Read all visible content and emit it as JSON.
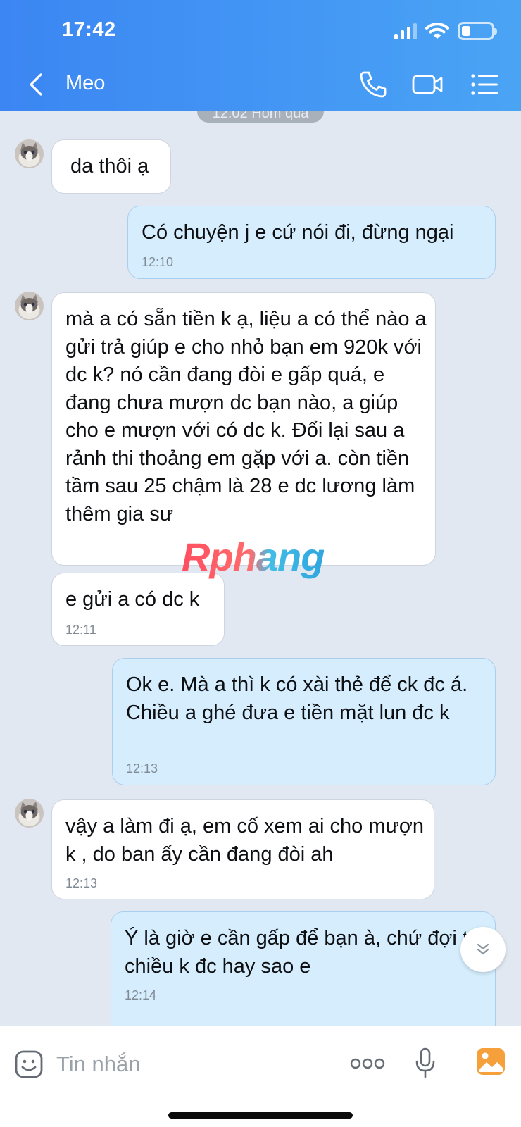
{
  "status_bar": {
    "time": "17:42",
    "battery_level": 0.3
  },
  "header": {
    "contact_name": "Meo"
  },
  "date_separator": "12:02 Hôm qua",
  "messages": [
    {
      "sender": "them",
      "text": "da thôi ạ",
      "time": ""
    },
    {
      "sender": "me",
      "text": "Có chuyện j e cứ nói đi, đừng ngại",
      "time": "12:10"
    },
    {
      "sender": "them",
      "text": "mà a có sẵn tiền k ạ, liệu a có thể nào a gửi trả giúp e cho nhỏ bạn em 920k với dc k? nó cần đang đòi e gấp quá, e đang chưa mượn dc bạn nào, a giúp cho e mượn với có dc k. Đổi lại sau a rảnh thi thoảng em gặp với a. còn tiền tầm sau 25 chậm là 28 e dc lương làm thêm gia sư",
      "time": ""
    },
    {
      "sender": "them",
      "text": "e gửi a có dc k",
      "time": "12:11"
    },
    {
      "sender": "me",
      "text": "Ok e. Mà a thì k có xài thẻ để ck đc á. Chiều a ghé đưa e tiền mặt lun đc k",
      "time": "12:13"
    },
    {
      "sender": "them",
      "text": "vậy a làm đi ạ, em cố xem ai cho mượn k , do ban ấy cần đang đòi ah",
      "time": "12:13"
    },
    {
      "sender": "me",
      "text": "Ý là giờ e cần gấp để bạn à, chứ đợi tới chiều k đc hay sao e",
      "time": "12:14"
    }
  ],
  "watermark": "Rphang",
  "composer": {
    "placeholder": "Tin nhắn"
  },
  "icons": {
    "back": "chevron-left-icon",
    "call": "phone-icon",
    "video": "video-camera-icon",
    "menu": "list-menu-icon",
    "sticker": "smiley-icon",
    "more": "more-dots-icon",
    "voice": "microphone-icon",
    "photo": "photo-gallery-icon",
    "scroll": "double-chevron-down-icon"
  },
  "colors": {
    "header_start": "#3b86f3",
    "header_end": "#4aa4f4",
    "bubble_out": "#d5edfd",
    "bubble_in": "#ffffff",
    "chat_background": "#e2e8f1",
    "photo_icon": "#f5a03a"
  }
}
